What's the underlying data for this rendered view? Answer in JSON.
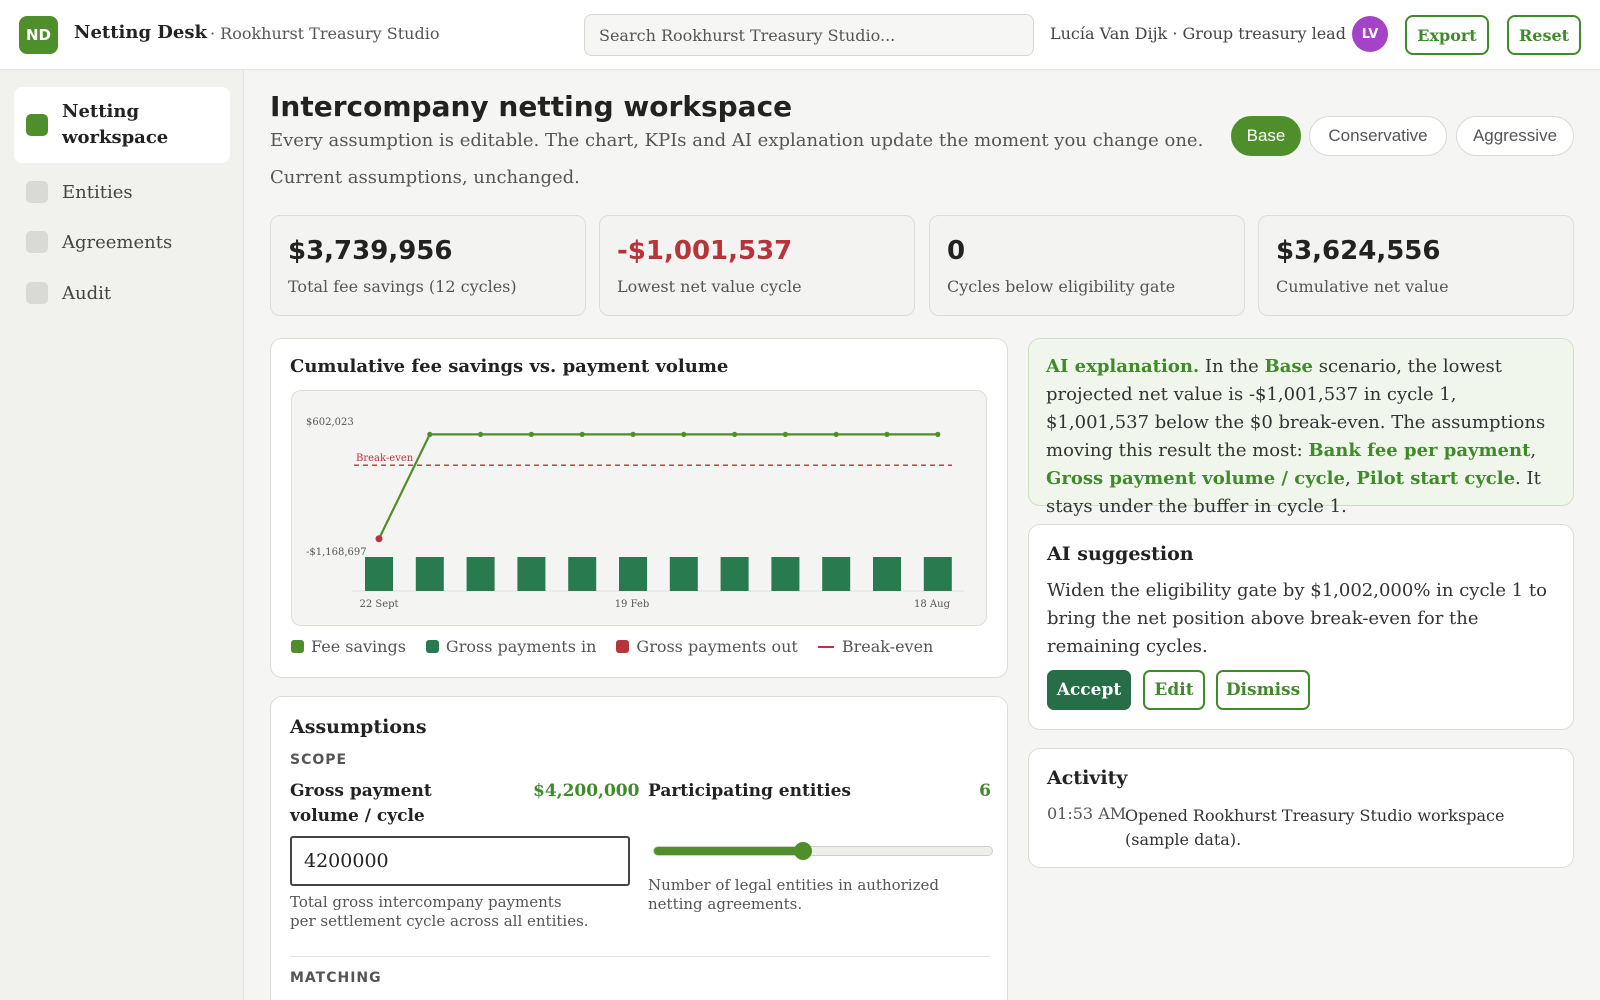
{
  "header": {
    "logo": "ND",
    "app_name": "Netting Desk",
    "app_sub": "· Rookhurst Treasury Studio",
    "search_placeholder": "Search Rookhurst Treasury Studio...",
    "user": "Lucía Van Dijk · Group treasury lead",
    "avatar": "LV",
    "export_label": "Export",
    "reset_label": "Reset"
  },
  "sidebar": {
    "items": [
      {
        "label": "Netting workspace",
        "active": true
      },
      {
        "label": "Entities",
        "active": false
      },
      {
        "label": "Agreements",
        "active": false
      },
      {
        "label": "Audit",
        "active": false
      }
    ]
  },
  "page": {
    "title": "Intercompany netting workspace",
    "subtitle": "Every assumption is editable. The chart, KPIs and AI explanation update the moment you change one.",
    "status": "Current assumptions, unchanged.",
    "scenarios": [
      "Base",
      "Conservative",
      "Aggressive"
    ],
    "active_scenario": "Base"
  },
  "kpis": [
    {
      "value": "$3,739,956",
      "label": "Total fee savings (12 cycles)",
      "negative": false
    },
    {
      "value": "-$1,001,537",
      "label": "Lowest net value cycle",
      "negative": true
    },
    {
      "value": "0",
      "label": "Cycles below eligibility gate",
      "negative": false
    },
    {
      "value": "$3,624,556",
      "label": "Cumulative net value",
      "negative": false
    }
  ],
  "chart": {
    "title": "Cumulative fee savings vs. payment volume",
    "legend": [
      "Fee savings",
      "Gross payments in",
      "Gross payments out",
      "Break-even"
    ]
  },
  "colors": {
    "accent": "#4e8f2b",
    "payments_in": "#2a7a4f",
    "payments_out": "#b8343a",
    "break_even": "#b8343a"
  },
  "chart_data": {
    "type": "line",
    "title": "Cumulative fee savings vs. payment volume",
    "x_tick_labels": [
      "22 Sept",
      "19 Feb",
      "18 Aug"
    ],
    "y_tick_labels": [
      "$602,023",
      "-$1,168,697"
    ],
    "ylim": [
      -1168697,
      602023
    ],
    "annotation": "Break-even",
    "break_even_value": 0,
    "series": [
      {
        "name": "Fee savings",
        "kind": "line",
        "values": [
          -1001537,
          420000,
          420000,
          420000,
          420000,
          420000,
          420000,
          420000,
          420000,
          420000,
          420000,
          420000
        ]
      },
      {
        "name": "Gross payments in",
        "kind": "bar",
        "values": [
          1,
          1,
          1,
          1,
          1,
          1,
          1,
          1,
          1,
          1,
          1,
          1
        ]
      }
    ],
    "legend_position": "bottom"
  },
  "assumptions": {
    "title": "Assumptions",
    "section_scope": "SCOPE",
    "gpv_label": "Gross payment volume / cycle",
    "gpv_value": "$4,200,000",
    "gpv_input": "4200000",
    "gpv_help": "Total gross intercompany payments per settlement cycle across all entities.",
    "entities_label": "Participating entities",
    "entities_value": "6",
    "entities_fraction": 0.44,
    "entities_help": "Number of legal entities in authorized netting agreements.",
    "section_matching": "MATCHING"
  },
  "ai_explanation": {
    "lead": "AI explanation.",
    "t1": " In the ",
    "scenario": "Base",
    "t2": " scenario, the lowest projected net value is -$1,001,537 in cycle 1, $1,001,537 below the $0 break-even. The assumptions moving this result the most: ",
    "d1": "Bank fee per payment",
    "sep1": ", ",
    "d2": "Gross payment volume / cycle",
    "sep2": ", ",
    "d3": "Pilot start cycle",
    "t3": ". It stays under the buffer in cycle 1."
  },
  "ai_suggestion": {
    "title": "AI suggestion",
    "body": "Widen the eligibility gate by $1,002,000% in cycle 1 to bring the net position above break-even for the remaining cycles.",
    "accept": "Accept",
    "edit": "Edit",
    "dismiss": "Dismiss"
  },
  "activity": {
    "title": "Activity",
    "entries": [
      {
        "time": "01:53 AM",
        "text": "Opened Rookhurst Treasury Studio workspace (sample data)."
      }
    ]
  }
}
